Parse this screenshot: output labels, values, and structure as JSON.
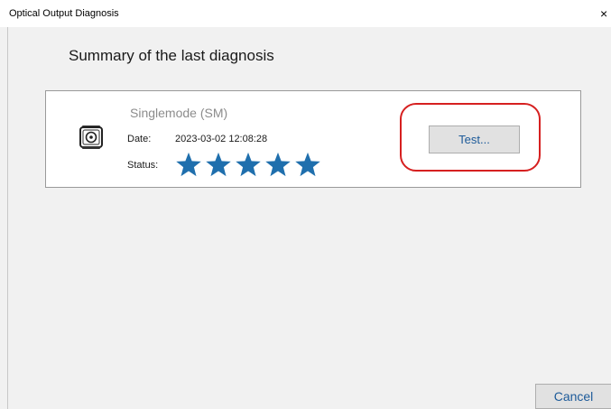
{
  "window": {
    "title": "Optical Output Diagnosis",
    "close_glyph": "×"
  },
  "main": {
    "heading": "Summary of the last diagnosis"
  },
  "diagnosis": {
    "icon": "fiber-connector-icon",
    "mode": "Singlemode (SM)",
    "date_label": "Date:",
    "date_value": "2023-03-02 12:08:28",
    "status_label": "Status:",
    "status_rating": 5,
    "status_max": 5,
    "star_color": "#1f6fad",
    "test_button_label": "Test...",
    "highlight_color": "#d62020"
  },
  "footer": {
    "cancel_label": "Cancel"
  },
  "colors": {
    "accent_text": "#1c5a99",
    "window_bg": "#f1f1f1",
    "panel_bg": "#ffffff"
  }
}
